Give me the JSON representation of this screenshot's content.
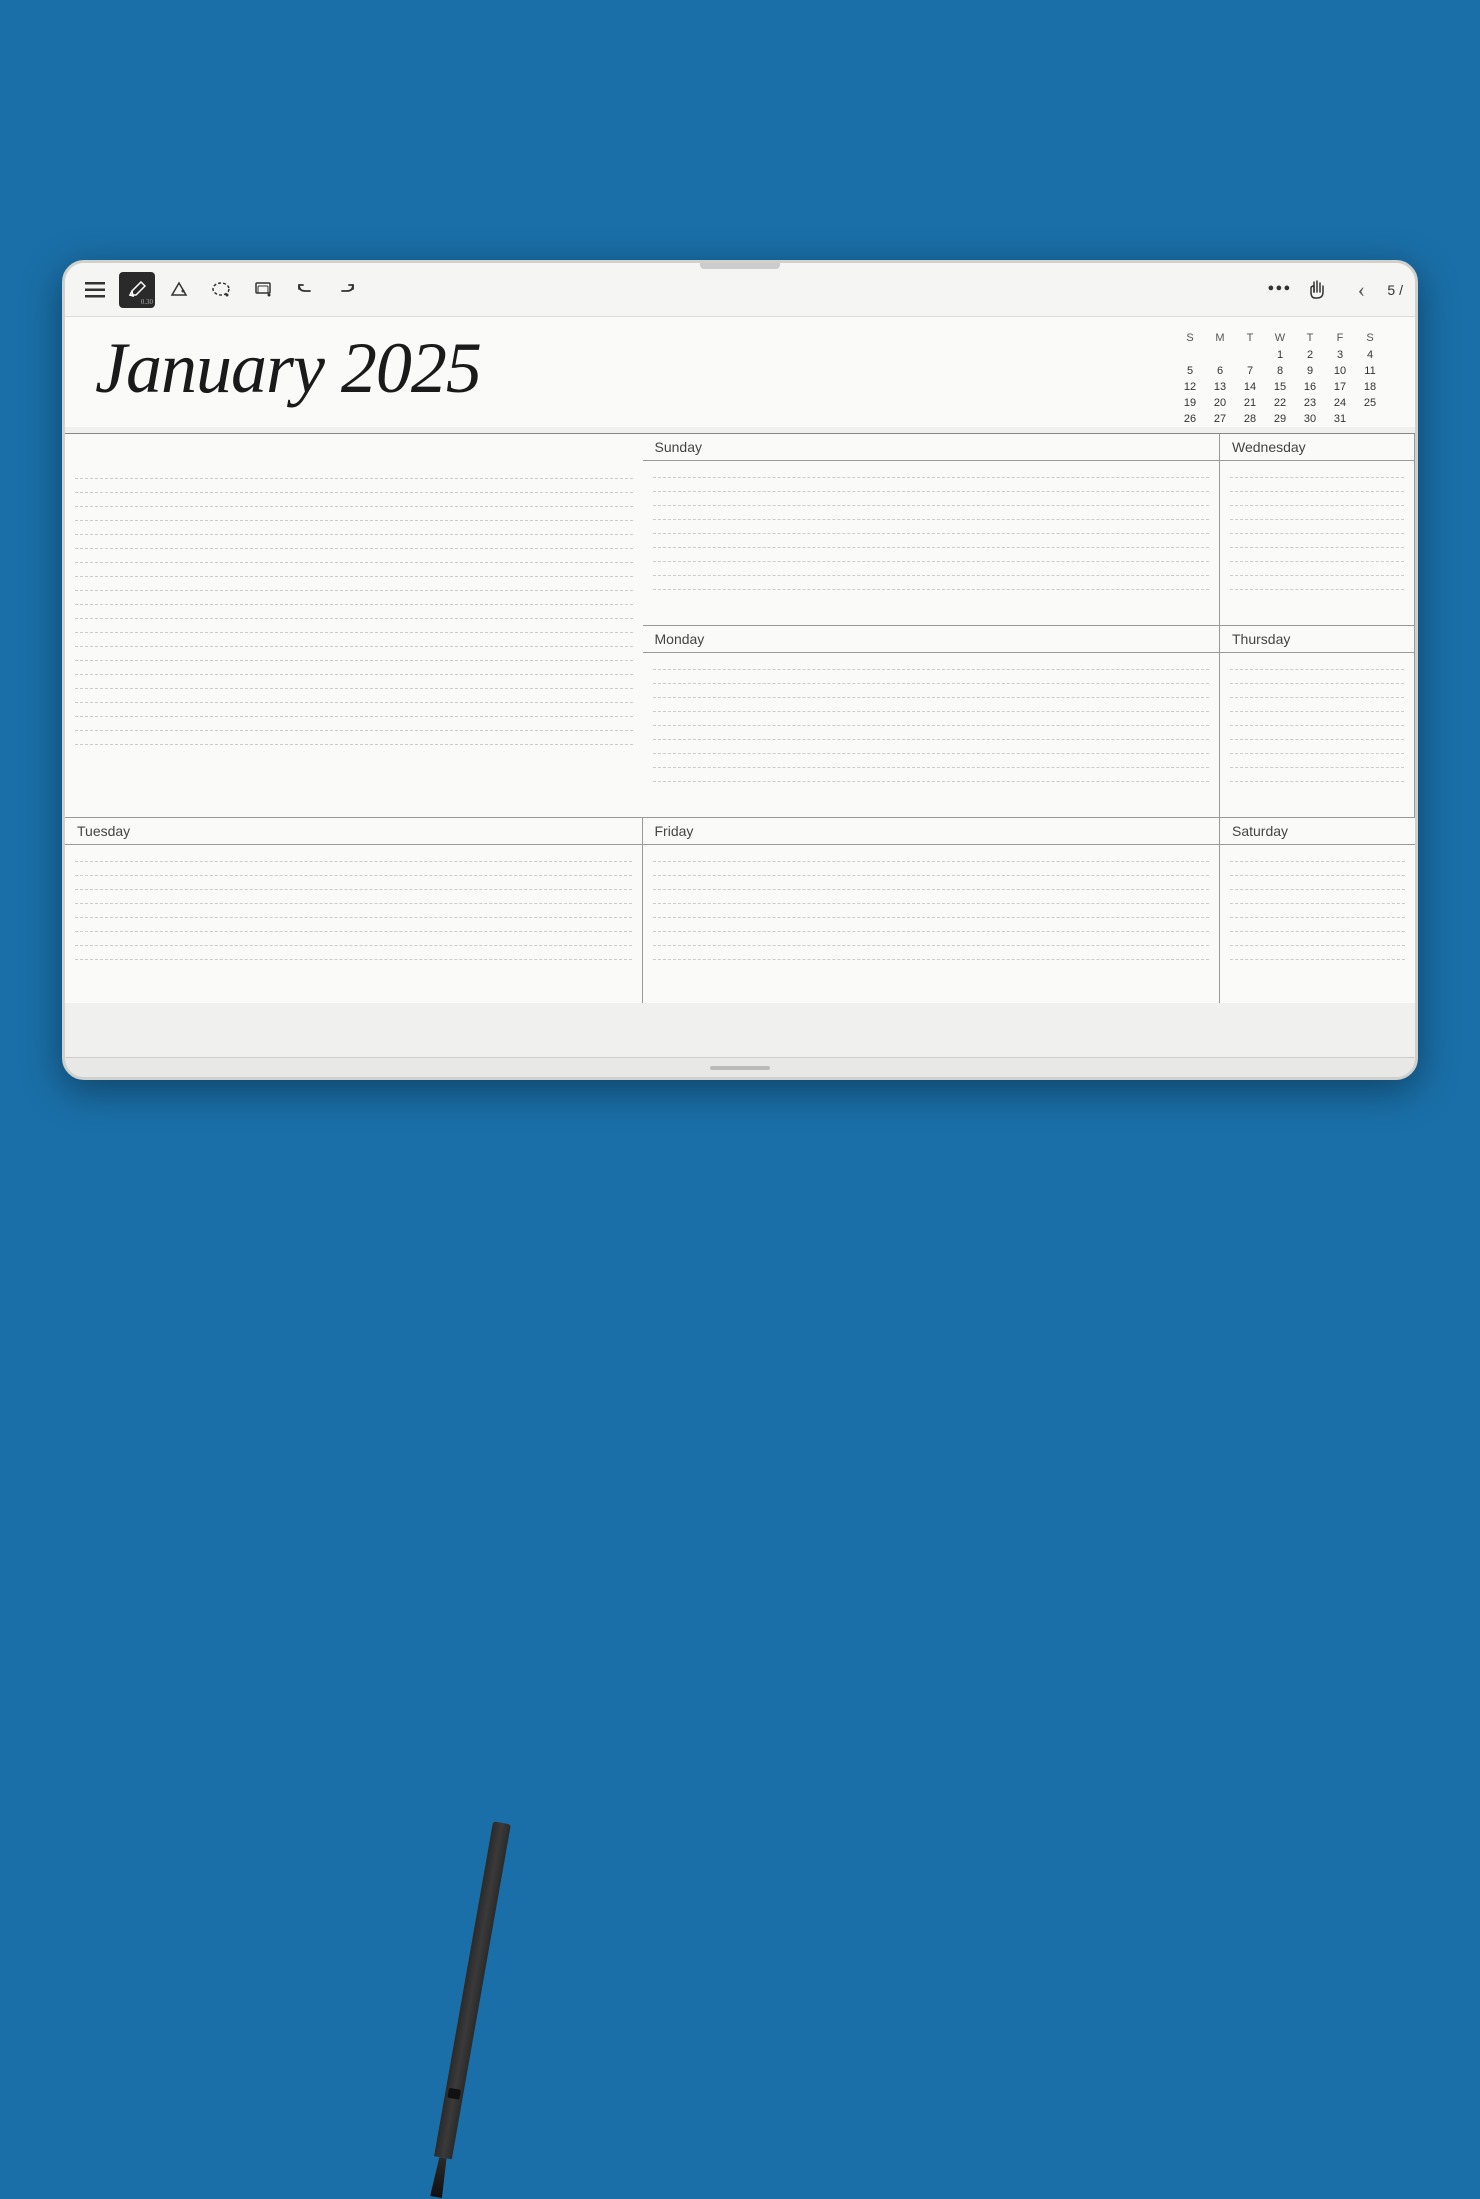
{
  "background": {
    "color": "#1a6fa8"
  },
  "device": {
    "toolbar": {
      "icons": [
        {
          "name": "menu-icon",
          "symbol": "☰",
          "active": false
        },
        {
          "name": "pen-icon",
          "symbol": "✏",
          "active": true,
          "sublabel": "0.30"
        },
        {
          "name": "shape-icon",
          "symbol": "◆",
          "active": false
        },
        {
          "name": "lasso-icon",
          "symbol": "⬡",
          "active": false
        },
        {
          "name": "eraser-icon",
          "symbol": "⌂",
          "active": false
        },
        {
          "name": "undo-icon",
          "symbol": "↺",
          "active": false
        },
        {
          "name": "redo-icon",
          "symbol": "↻",
          "active": false
        }
      ],
      "right": {
        "more_label": "•••",
        "hand_symbol": "☞",
        "back_symbol": "‹",
        "page_label": "5 /"
      }
    },
    "planner": {
      "title": "January 2025",
      "mini_calendar": {
        "days_header": [
          "S",
          "M",
          "T",
          "W",
          "T",
          "F",
          "S"
        ],
        "weeks": [
          [
            "",
            "",
            "",
            "1",
            "2",
            "3",
            "4"
          ],
          [
            "5",
            "6",
            "7",
            "8",
            "9",
            "10",
            "11"
          ],
          [
            "12",
            "13",
            "14",
            "15",
            "16",
            "17",
            "18"
          ],
          [
            "19",
            "20",
            "21",
            "22",
            "23",
            "24",
            "25"
          ],
          [
            "26",
            "27",
            "28",
            "29",
            "30",
            "31",
            ""
          ]
        ]
      },
      "days": {
        "sunday": "Sunday",
        "monday": "Monday",
        "tuesday": "Tuesday",
        "wednesday": "Wednesday",
        "thursday": "Thursday",
        "friday": "Friday",
        "saturday": "Saturday"
      }
    }
  },
  "stylus": {
    "visible": true
  }
}
